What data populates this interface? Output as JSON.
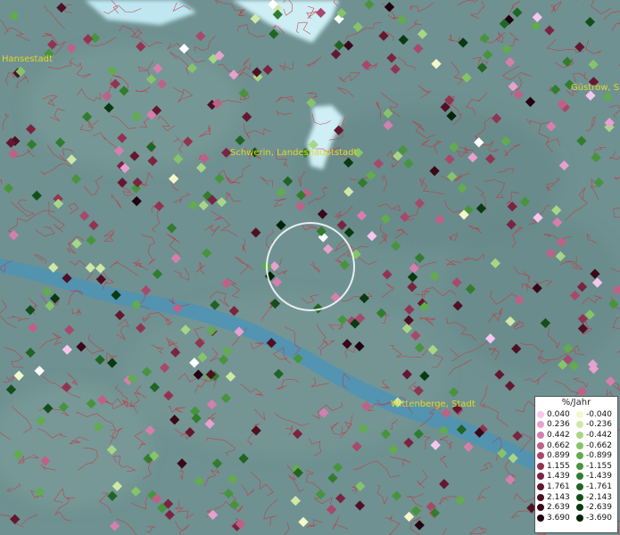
{
  "map": {
    "places": [
      {
        "name": "Hansestadt"
      },
      {
        "name": "Schwerin, Landeshauptstadt"
      },
      {
        "name": "Güstrow, S"
      },
      {
        "name": "Wittenberge, Stadt"
      }
    ]
  },
  "legend": {
    "title": "%/Jahr",
    "positive": [
      {
        "label": "0.040",
        "color": "#f7c6ef"
      },
      {
        "label": "0.236",
        "color": "#e8a0cf"
      },
      {
        "label": "0.442",
        "color": "#d67fae"
      },
      {
        "label": "0.662",
        "color": "#c06088"
      },
      {
        "label": "0.899",
        "color": "#a8486a"
      },
      {
        "label": "1.155",
        "color": "#913452"
      },
      {
        "label": "1.439",
        "color": "#7a2440"
      },
      {
        "label": "1.761",
        "color": "#641830"
      },
      {
        "label": "2.143",
        "color": "#4f1024"
      },
      {
        "label": "2.639",
        "color": "#3a0818"
      },
      {
        "label": "3.690",
        "color": "#220010"
      }
    ],
    "negative": [
      {
        "label": "-0.040",
        "color": "#f4f8c8"
      },
      {
        "label": "-0.236",
        "color": "#cfe8a6"
      },
      {
        "label": "-0.442",
        "color": "#a8d686"
      },
      {
        "label": "-0.662",
        "color": "#86c46a"
      },
      {
        "label": "-0.899",
        "color": "#62ab4e"
      },
      {
        "label": "-1.155",
        "color": "#48943c"
      },
      {
        "label": "-1.439",
        "color": "#327c2e"
      },
      {
        "label": "-1.761",
        "color": "#216524"
      },
      {
        "label": "-2.143",
        "color": "#134f1a"
      },
      {
        "label": "-2.639",
        "color": "#093a10"
      },
      {
        "label": "-3.690",
        "color": "#022406"
      }
    ]
  },
  "colors": {
    "background": "#6f9191",
    "borders": "#c8343c",
    "water": "#4f94b4",
    "label": "#e2d82a",
    "point_white": "#ffffff"
  }
}
